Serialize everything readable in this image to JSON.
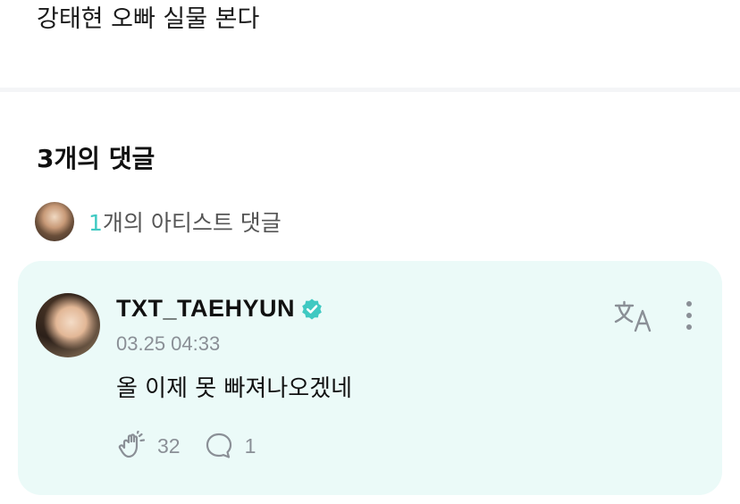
{
  "post": {
    "text": "강태현 오빠 실물 본다"
  },
  "comments": {
    "count_label": "3개의 댓글"
  },
  "artist_comments": {
    "count": "1",
    "label": "개의 아티스트 댓글"
  },
  "comment": {
    "username": "TXT_TAEHYUN",
    "timestamp": "03.25 04:33",
    "body": "올 이제 못 빠져나오겠네",
    "likes": "32",
    "replies": "1"
  },
  "icons": {
    "verified": "verified-badge-icon",
    "translate": "translate-icon",
    "more": "more-vertical-icon",
    "like": "cheer-hand-icon",
    "reply": "speech-bubble-icon"
  },
  "colors": {
    "accent": "#3fc9c2",
    "card_bg": "#ebfaf8",
    "muted": "#8a8f96"
  }
}
